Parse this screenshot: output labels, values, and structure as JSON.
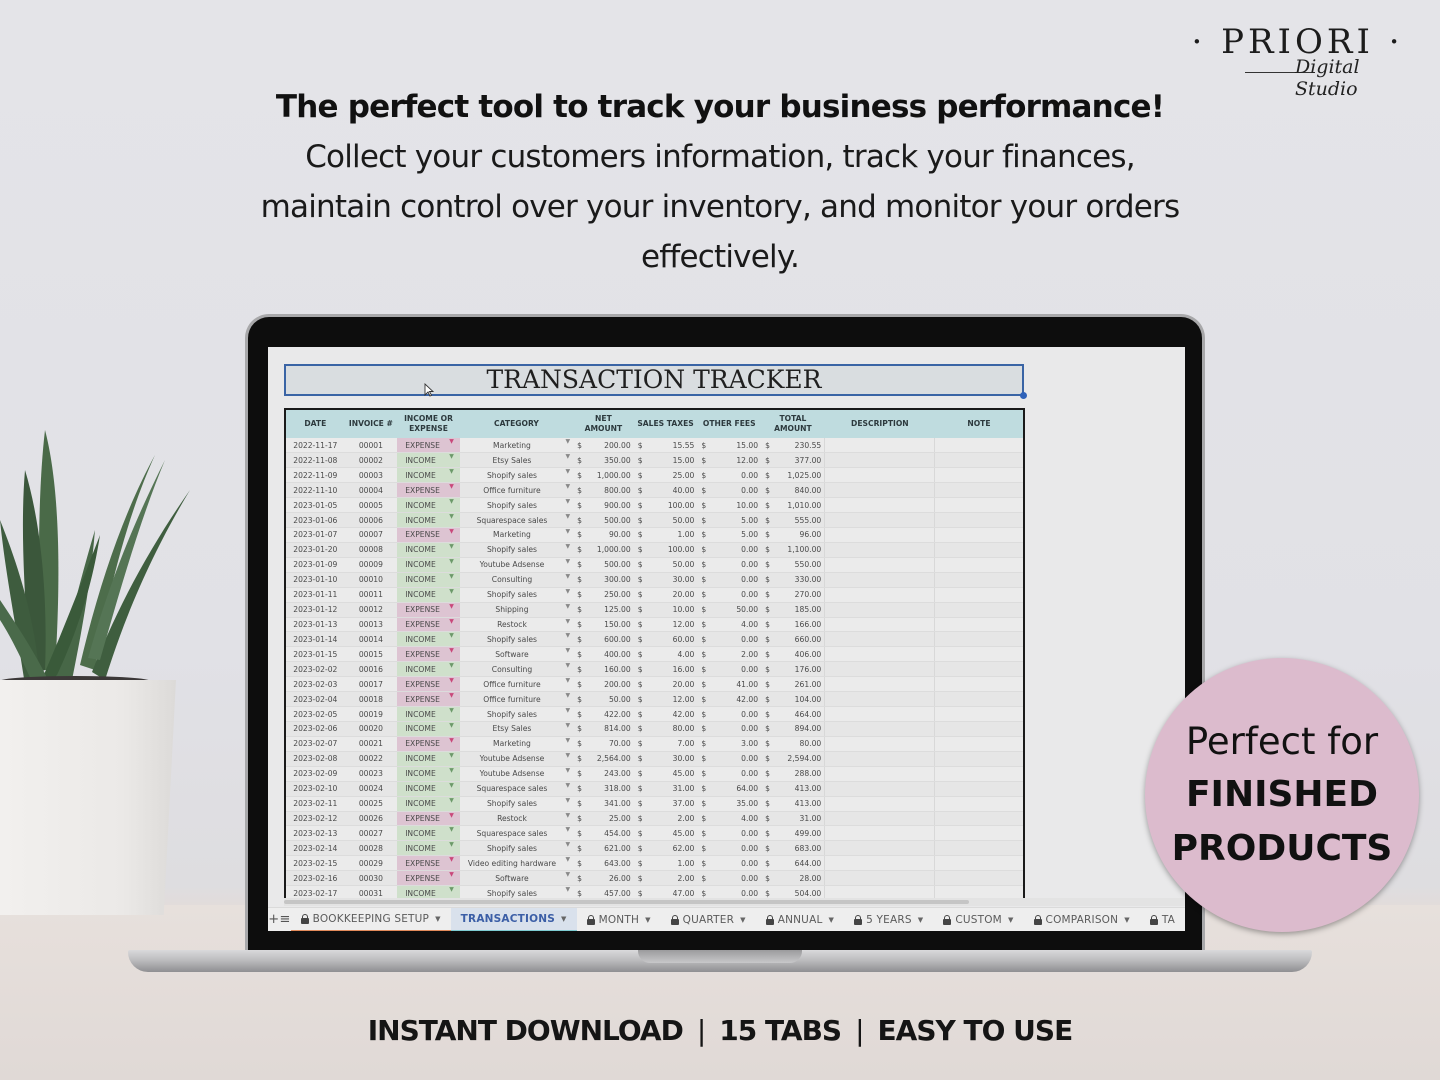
{
  "logo": {
    "brand": "· PRIORI ·",
    "tagline": "Digital Studio"
  },
  "headline": {
    "title": "The perfect tool to track your business performance!",
    "lines": [
      "Collect your customers information, track your finances,",
      "maintain control over your inventory, and monitor your orders",
      "effectively."
    ]
  },
  "sheet": {
    "title": "TRANSACTION TRACKER",
    "columns": [
      "DATE",
      "INVOICE #",
      "INCOME OR EXPENSE",
      "CATEGORY",
      "NET AMOUNT",
      "SALES TAXES",
      "OTHER FEES",
      "TOTAL AMOUNT",
      "DESCRIPTION",
      "NOTE"
    ],
    "currency_symbol": "$",
    "rows": [
      {
        "date": "2022-11-17",
        "invoice": "00001",
        "type": "EXPENSE",
        "category": "Marketing",
        "net": "200.00",
        "tax": "15.55",
        "fees": "15.00",
        "total": "230.55"
      },
      {
        "date": "2022-11-08",
        "invoice": "00002",
        "type": "INCOME",
        "category": "Etsy Sales",
        "net": "350.00",
        "tax": "15.00",
        "fees": "12.00",
        "total": "377.00"
      },
      {
        "date": "2022-11-09",
        "invoice": "00003",
        "type": "INCOME",
        "category": "Shopify sales",
        "net": "1,000.00",
        "tax": "25.00",
        "fees": "0.00",
        "total": "1,025.00"
      },
      {
        "date": "2022-11-10",
        "invoice": "00004",
        "type": "EXPENSE",
        "category": "Office furniture",
        "net": "800.00",
        "tax": "40.00",
        "fees": "0.00",
        "total": "840.00"
      },
      {
        "date": "2023-01-05",
        "invoice": "00005",
        "type": "INCOME",
        "category": "Shopify sales",
        "net": "900.00",
        "tax": "100.00",
        "fees": "10.00",
        "total": "1,010.00"
      },
      {
        "date": "2023-01-06",
        "invoice": "00006",
        "type": "INCOME",
        "category": "Squarespace sales",
        "net": "500.00",
        "tax": "50.00",
        "fees": "5.00",
        "total": "555.00"
      },
      {
        "date": "2023-01-07",
        "invoice": "00007",
        "type": "EXPENSE",
        "category": "Marketing",
        "net": "90.00",
        "tax": "1.00",
        "fees": "5.00",
        "total": "96.00"
      },
      {
        "date": "2023-01-20",
        "invoice": "00008",
        "type": "INCOME",
        "category": "Shopify sales",
        "net": "1,000.00",
        "tax": "100.00",
        "fees": "0.00",
        "total": "1,100.00"
      },
      {
        "date": "2023-01-09",
        "invoice": "00009",
        "type": "INCOME",
        "category": "Youtube Adsense",
        "net": "500.00",
        "tax": "50.00",
        "fees": "0.00",
        "total": "550.00"
      },
      {
        "date": "2023-01-10",
        "invoice": "00010",
        "type": "INCOME",
        "category": "Consulting",
        "net": "300.00",
        "tax": "30.00",
        "fees": "0.00",
        "total": "330.00"
      },
      {
        "date": "2023-01-11",
        "invoice": "00011",
        "type": "INCOME",
        "category": "Shopify sales",
        "net": "250.00",
        "tax": "20.00",
        "fees": "0.00",
        "total": "270.00"
      },
      {
        "date": "2023-01-12",
        "invoice": "00012",
        "type": "EXPENSE",
        "category": "Shipping",
        "net": "125.00",
        "tax": "10.00",
        "fees": "50.00",
        "total": "185.00"
      },
      {
        "date": "2023-01-13",
        "invoice": "00013",
        "type": "EXPENSE",
        "category": "Restock",
        "net": "150.00",
        "tax": "12.00",
        "fees": "4.00",
        "total": "166.00"
      },
      {
        "date": "2023-01-14",
        "invoice": "00014",
        "type": "INCOME",
        "category": "Shopify sales",
        "net": "600.00",
        "tax": "60.00",
        "fees": "0.00",
        "total": "660.00"
      },
      {
        "date": "2023-01-15",
        "invoice": "00015",
        "type": "EXPENSE",
        "category": "Software",
        "net": "400.00",
        "tax": "4.00",
        "fees": "2.00",
        "total": "406.00"
      },
      {
        "date": "2023-02-02",
        "invoice": "00016",
        "type": "INCOME",
        "category": "Consulting",
        "net": "160.00",
        "tax": "16.00",
        "fees": "0.00",
        "total": "176.00"
      },
      {
        "date": "2023-02-03",
        "invoice": "00017",
        "type": "EXPENSE",
        "category": "Office furniture",
        "net": "200.00",
        "tax": "20.00",
        "fees": "41.00",
        "total": "261.00"
      },
      {
        "date": "2023-02-04",
        "invoice": "00018",
        "type": "EXPENSE",
        "category": "Office furniture",
        "net": "50.00",
        "tax": "12.00",
        "fees": "42.00",
        "total": "104.00"
      },
      {
        "date": "2023-02-05",
        "invoice": "00019",
        "type": "INCOME",
        "category": "Shopify sales",
        "net": "422.00",
        "tax": "42.00",
        "fees": "0.00",
        "total": "464.00"
      },
      {
        "date": "2023-02-06",
        "invoice": "00020",
        "type": "INCOME",
        "category": "Etsy Sales",
        "net": "814.00",
        "tax": "80.00",
        "fees": "0.00",
        "total": "894.00"
      },
      {
        "date": "2023-02-07",
        "invoice": "00021",
        "type": "EXPENSE",
        "category": "Marketing",
        "net": "70.00",
        "tax": "7.00",
        "fees": "3.00",
        "total": "80.00"
      },
      {
        "date": "2023-02-08",
        "invoice": "00022",
        "type": "INCOME",
        "category": "Youtube Adsense",
        "net": "2,564.00",
        "tax": "30.00",
        "fees": "0.00",
        "total": "2,594.00"
      },
      {
        "date": "2023-02-09",
        "invoice": "00023",
        "type": "INCOME",
        "category": "Youtube Adsense",
        "net": "243.00",
        "tax": "45.00",
        "fees": "0.00",
        "total": "288.00"
      },
      {
        "date": "2023-02-10",
        "invoice": "00024",
        "type": "INCOME",
        "category": "Squarespace sales",
        "net": "318.00",
        "tax": "31.00",
        "fees": "64.00",
        "total": "413.00"
      },
      {
        "date": "2023-02-11",
        "invoice": "00025",
        "type": "INCOME",
        "category": "Shopify sales",
        "net": "341.00",
        "tax": "37.00",
        "fees": "35.00",
        "total": "413.00"
      },
      {
        "date": "2023-02-12",
        "invoice": "00026",
        "type": "EXPENSE",
        "category": "Restock",
        "net": "25.00",
        "tax": "2.00",
        "fees": "4.00",
        "total": "31.00"
      },
      {
        "date": "2023-02-13",
        "invoice": "00027",
        "type": "INCOME",
        "category": "Squarespace sales",
        "net": "454.00",
        "tax": "45.00",
        "fees": "0.00",
        "total": "499.00"
      },
      {
        "date": "2023-02-14",
        "invoice": "00028",
        "type": "INCOME",
        "category": "Shopify sales",
        "net": "621.00",
        "tax": "62.00",
        "fees": "0.00",
        "total": "683.00"
      },
      {
        "date": "2023-02-15",
        "invoice": "00029",
        "type": "EXPENSE",
        "category": "Video editing hardware",
        "net": "643.00",
        "tax": "1.00",
        "fees": "0.00",
        "total": "644.00"
      },
      {
        "date": "2023-02-16",
        "invoice": "00030",
        "type": "EXPENSE",
        "category": "Software",
        "net": "26.00",
        "tax": "2.00",
        "fees": "0.00",
        "total": "28.00"
      },
      {
        "date": "2023-02-17",
        "invoice": "00031",
        "type": "INCOME",
        "category": "Shopify sales",
        "net": "457.00",
        "tax": "47.00",
        "fees": "0.00",
        "total": "504.00"
      }
    ]
  },
  "tabbar": {
    "add_icon": "+",
    "menu_icon": "≡",
    "tabs": [
      {
        "label": "BOOKKEEPING SETUP",
        "locked": true,
        "active": false
      },
      {
        "label": "TRANSACTIONS",
        "locked": false,
        "active": true
      },
      {
        "label": "MONTH",
        "locked": true,
        "active": false
      },
      {
        "label": "QUARTER",
        "locked": true,
        "active": false
      },
      {
        "label": "ANNUAL",
        "locked": true,
        "active": false
      },
      {
        "label": "5 YEARS",
        "locked": true,
        "active": false
      },
      {
        "label": "CUSTOM",
        "locked": true,
        "active": false
      },
      {
        "label": "COMPARISON",
        "locked": true,
        "active": false
      },
      {
        "label": "TA",
        "locked": true,
        "active": false
      }
    ]
  },
  "badge": {
    "line1": "Perfect for",
    "line2": "FINISHED",
    "line3": "PRODUCTS",
    "color": "#dcbbcd"
  },
  "footer": {
    "items": [
      "INSTANT DOWNLOAD",
      "15 TABS",
      "EASY TO USE"
    ],
    "separator": "|"
  },
  "colors": {
    "expense": "#ddc4d2",
    "income": "#cfe0cb",
    "header": "#bfdcdf",
    "active_tab": "#3b5ea6"
  }
}
